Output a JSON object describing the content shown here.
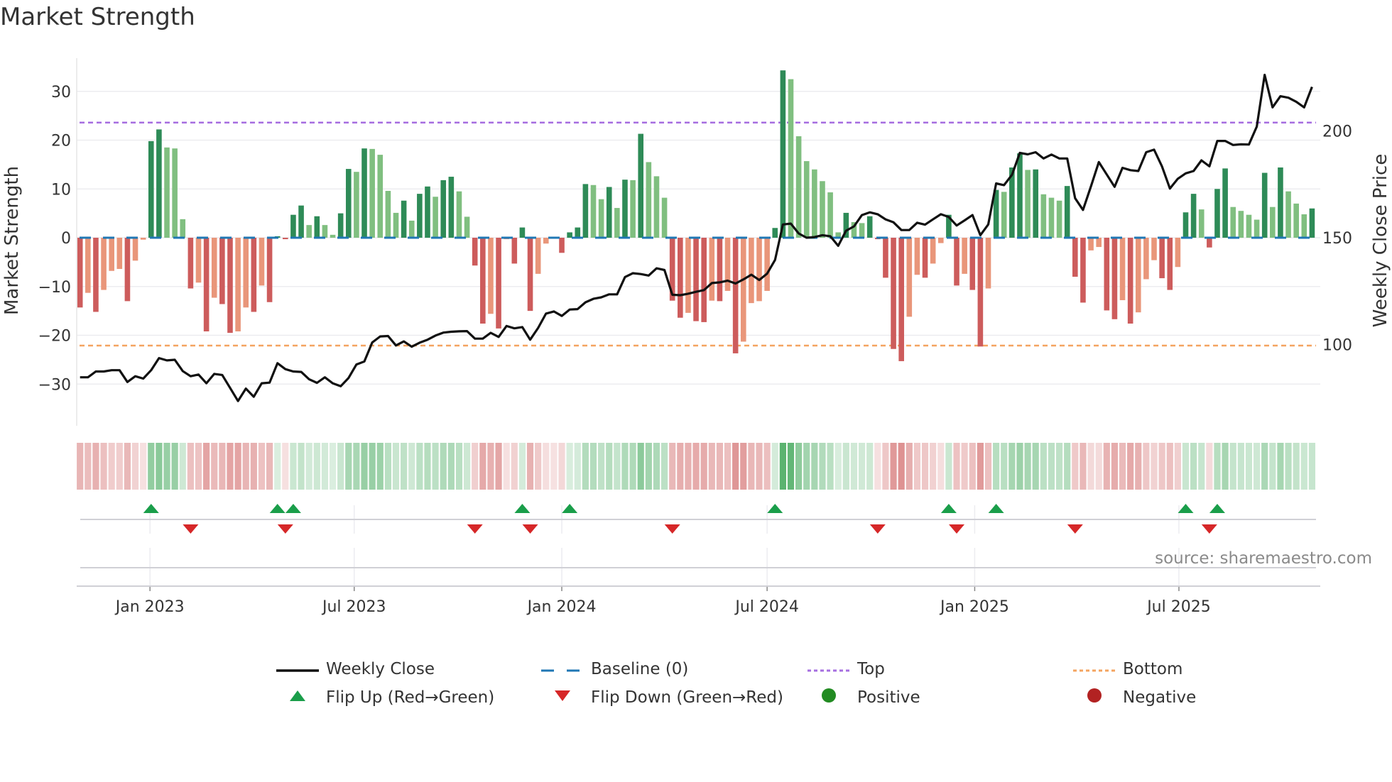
{
  "title": "Market Strength",
  "source": "source: sharemaestro.com",
  "colors": {
    "pos_strong": "#2e8b57",
    "pos_weak": "#80bf80",
    "neg_strong": "#cd5c5c",
    "neg_weak": "#e9967a",
    "baseline": "#1f77b4",
    "top": "#a66ee0",
    "bottom": "#f4a460",
    "close": "#111111",
    "flip_up": "#1a9e4a",
    "flip_down": "#d62728",
    "positive": "#228b22",
    "negative": "#b22222"
  },
  "legend": [
    {
      "label": "Weekly Close",
      "icon": "solid-line"
    },
    {
      "label": "Baseline (0)",
      "icon": "dashed-line"
    },
    {
      "label": "Top",
      "icon": "dotted-line-purple"
    },
    {
      "label": "Bottom",
      "icon": "dotted-line-orange"
    },
    {
      "label": "Flip Up (Red→Green)",
      "icon": "triangle-up"
    },
    {
      "label": "Flip Down (Green→Red)",
      "icon": "triangle-down"
    },
    {
      "label": "Positive",
      "icon": "circle-green"
    },
    {
      "label": "Negative",
      "icon": "circle-red"
    }
  ],
  "chart_data": {
    "type": "bar",
    "title": "Market Strength",
    "ylabel": "Market Strength",
    "y2label": "Weekly Close Price",
    "ylim": [
      -38.6,
      36.8
    ],
    "y2lim": [
      65,
      234
    ],
    "yticks": [
      30,
      20,
      10,
      0,
      -10,
      -20,
      -30
    ],
    "y2ticks": [
      200,
      150,
      100
    ],
    "xticks": [
      {
        "label": "Jan 2023",
        "date": "2023-01-01"
      },
      {
        "label": "Jul 2023",
        "date": "2023-07-01"
      },
      {
        "label": "Jan 2024",
        "date": "2024-01-01"
      },
      {
        "label": "Jul 2024",
        "date": "2024-07-01"
      },
      {
        "label": "Jan 2025",
        "date": "2025-01-01"
      },
      {
        "label": "Jul 2025",
        "date": "2025-07-01"
      }
    ],
    "start_week": "2022-10-31",
    "frequency": "weekly",
    "top_level": 23.6,
    "bottom_level": -22.1,
    "baseline": 0,
    "grid": true,
    "legend_position": "bottom",
    "strength": [
      -14.3,
      -11.3,
      -15.2,
      -10.7,
      -6.8,
      -6.4,
      -13.0,
      -4.7,
      -0.4,
      19.8,
      22.2,
      18.5,
      18.3,
      3.8,
      -10.4,
      -9.2,
      -19.2,
      -12.3,
      -13.6,
      -19.5,
      -19.2,
      -14.3,
      -15.2,
      -9.8,
      -13.2,
      0.3,
      -0.3,
      4.7,
      6.6,
      2.6,
      4.4,
      2.6,
      0.6,
      5.0,
      14.1,
      13.5,
      18.3,
      18.2,
      17.0,
      9.6,
      5.1,
      7.6,
      3.5,
      9.0,
      10.5,
      8.4,
      11.8,
      12.5,
      9.5,
      4.3,
      -5.7,
      -17.6,
      -15.6,
      -18.6,
      -0.3,
      -5.3,
      2.1,
      -15.0,
      -7.4,
      -1.2,
      -0.2,
      -3.1,
      1.1,
      2.1,
      11.0,
      10.8,
      7.9,
      10.4,
      6.1,
      11.9,
      11.8,
      21.3,
      15.5,
      12.6,
      8.2,
      -12.9,
      -16.4,
      -15.4,
      -17.1,
      -17.3,
      -12.9,
      -13.0,
      -10.9,
      -23.7,
      -21.3,
      -13.4,
      -13.0,
      -10.9,
      2.0,
      34.3,
      32.5,
      20.8,
      15.7,
      14.0,
      11.6,
      9.3,
      1.1,
      5.1,
      3.2,
      3.0,
      4.4,
      -0.3,
      -8.2,
      -22.8,
      -25.3,
      -16.2,
      -7.6,
      -8.2,
      -5.3,
      -1.1,
      4.7,
      -9.8,
      -7.4,
      -10.7,
      -22.3,
      -10.4,
      9.8,
      9.4,
      14.4,
      17.3,
      13.9,
      14.0,
      8.9,
      8.2,
      7.6,
      10.6,
      -8.0,
      -13.3,
      -2.6,
      -1.9,
      -14.9,
      -16.7,
      -12.8,
      -17.6,
      -15.3,
      -8.5,
      -4.6,
      -8.3,
      -10.7,
      -6.0,
      5.2,
      9.0,
      5.8,
      -2.0,
      10.0,
      14.2,
      6.3,
      5.5,
      4.7,
      3.7,
      13.3,
      6.3,
      14.4,
      9.5,
      7.0,
      4.8,
      6.0
    ],
    "weekly_close": [
      84.7,
      84.7,
      87.4,
      87.4,
      88,
      88,
      82.5,
      85.2,
      84.1,
      88,
      93.7,
      92.6,
      92.9,
      87.6,
      85.2,
      86,
      81.9,
      86.3,
      85.8,
      79.7,
      73.6,
      79.4,
      75.6,
      81.9,
      82.2,
      91.3,
      88.5,
      87.4,
      87.2,
      83.8,
      82.1,
      84.7,
      81.9,
      80.5,
      84.4,
      90.7,
      92.1,
      101,
      103.8,
      104,
      99.6,
      101.5,
      99,
      100.9,
      102.3,
      104.2,
      105.6,
      106,
      106.2,
      106.3,
      102.8,
      102.8,
      105.5,
      103.6,
      108.7,
      107.6,
      108.2,
      102.3,
      107.8,
      114.5,
      115.5,
      113.4,
      116.4,
      116.6,
      119.8,
      121.4,
      122.1,
      123.5,
      123.5,
      131.6,
      133.4,
      133,
      132.3,
      135.7,
      134.9,
      123.3,
      123.1,
      123.8,
      124.7,
      125.5,
      128.8,
      129.1,
      129.9,
      128.6,
      130.5,
      132.7,
      130.2,
      133.2,
      139.6,
      156.2,
      156.6,
      152,
      150,
      150.3,
      151.2,
      150.7,
      146.2,
      153.3,
      155.3,
      160.6,
      161.9,
      161,
      158.6,
      157.2,
      153.6,
      153.6,
      157,
      156.1,
      158.6,
      161,
      159.7,
      155.7,
      158.1,
      160.6,
      151.2,
      156.2,
      175.4,
      174.6,
      179.4,
      189.7,
      189,
      190,
      187.1,
      188.9,
      187.1,
      187.1,
      168.5,
      163,
      174,
      185.4,
      179.6,
      173.8,
      182.7,
      181.6,
      181.2,
      190,
      191.2,
      183.4,
      173,
      177.6,
      180.1,
      181.2,
      186.2,
      183.4,
      195.3,
      195.3,
      193.4,
      193.7,
      193.6,
      202,
      226.2,
      211,
      216.2,
      215.5,
      213.6,
      211,
      220.6
    ]
  }
}
